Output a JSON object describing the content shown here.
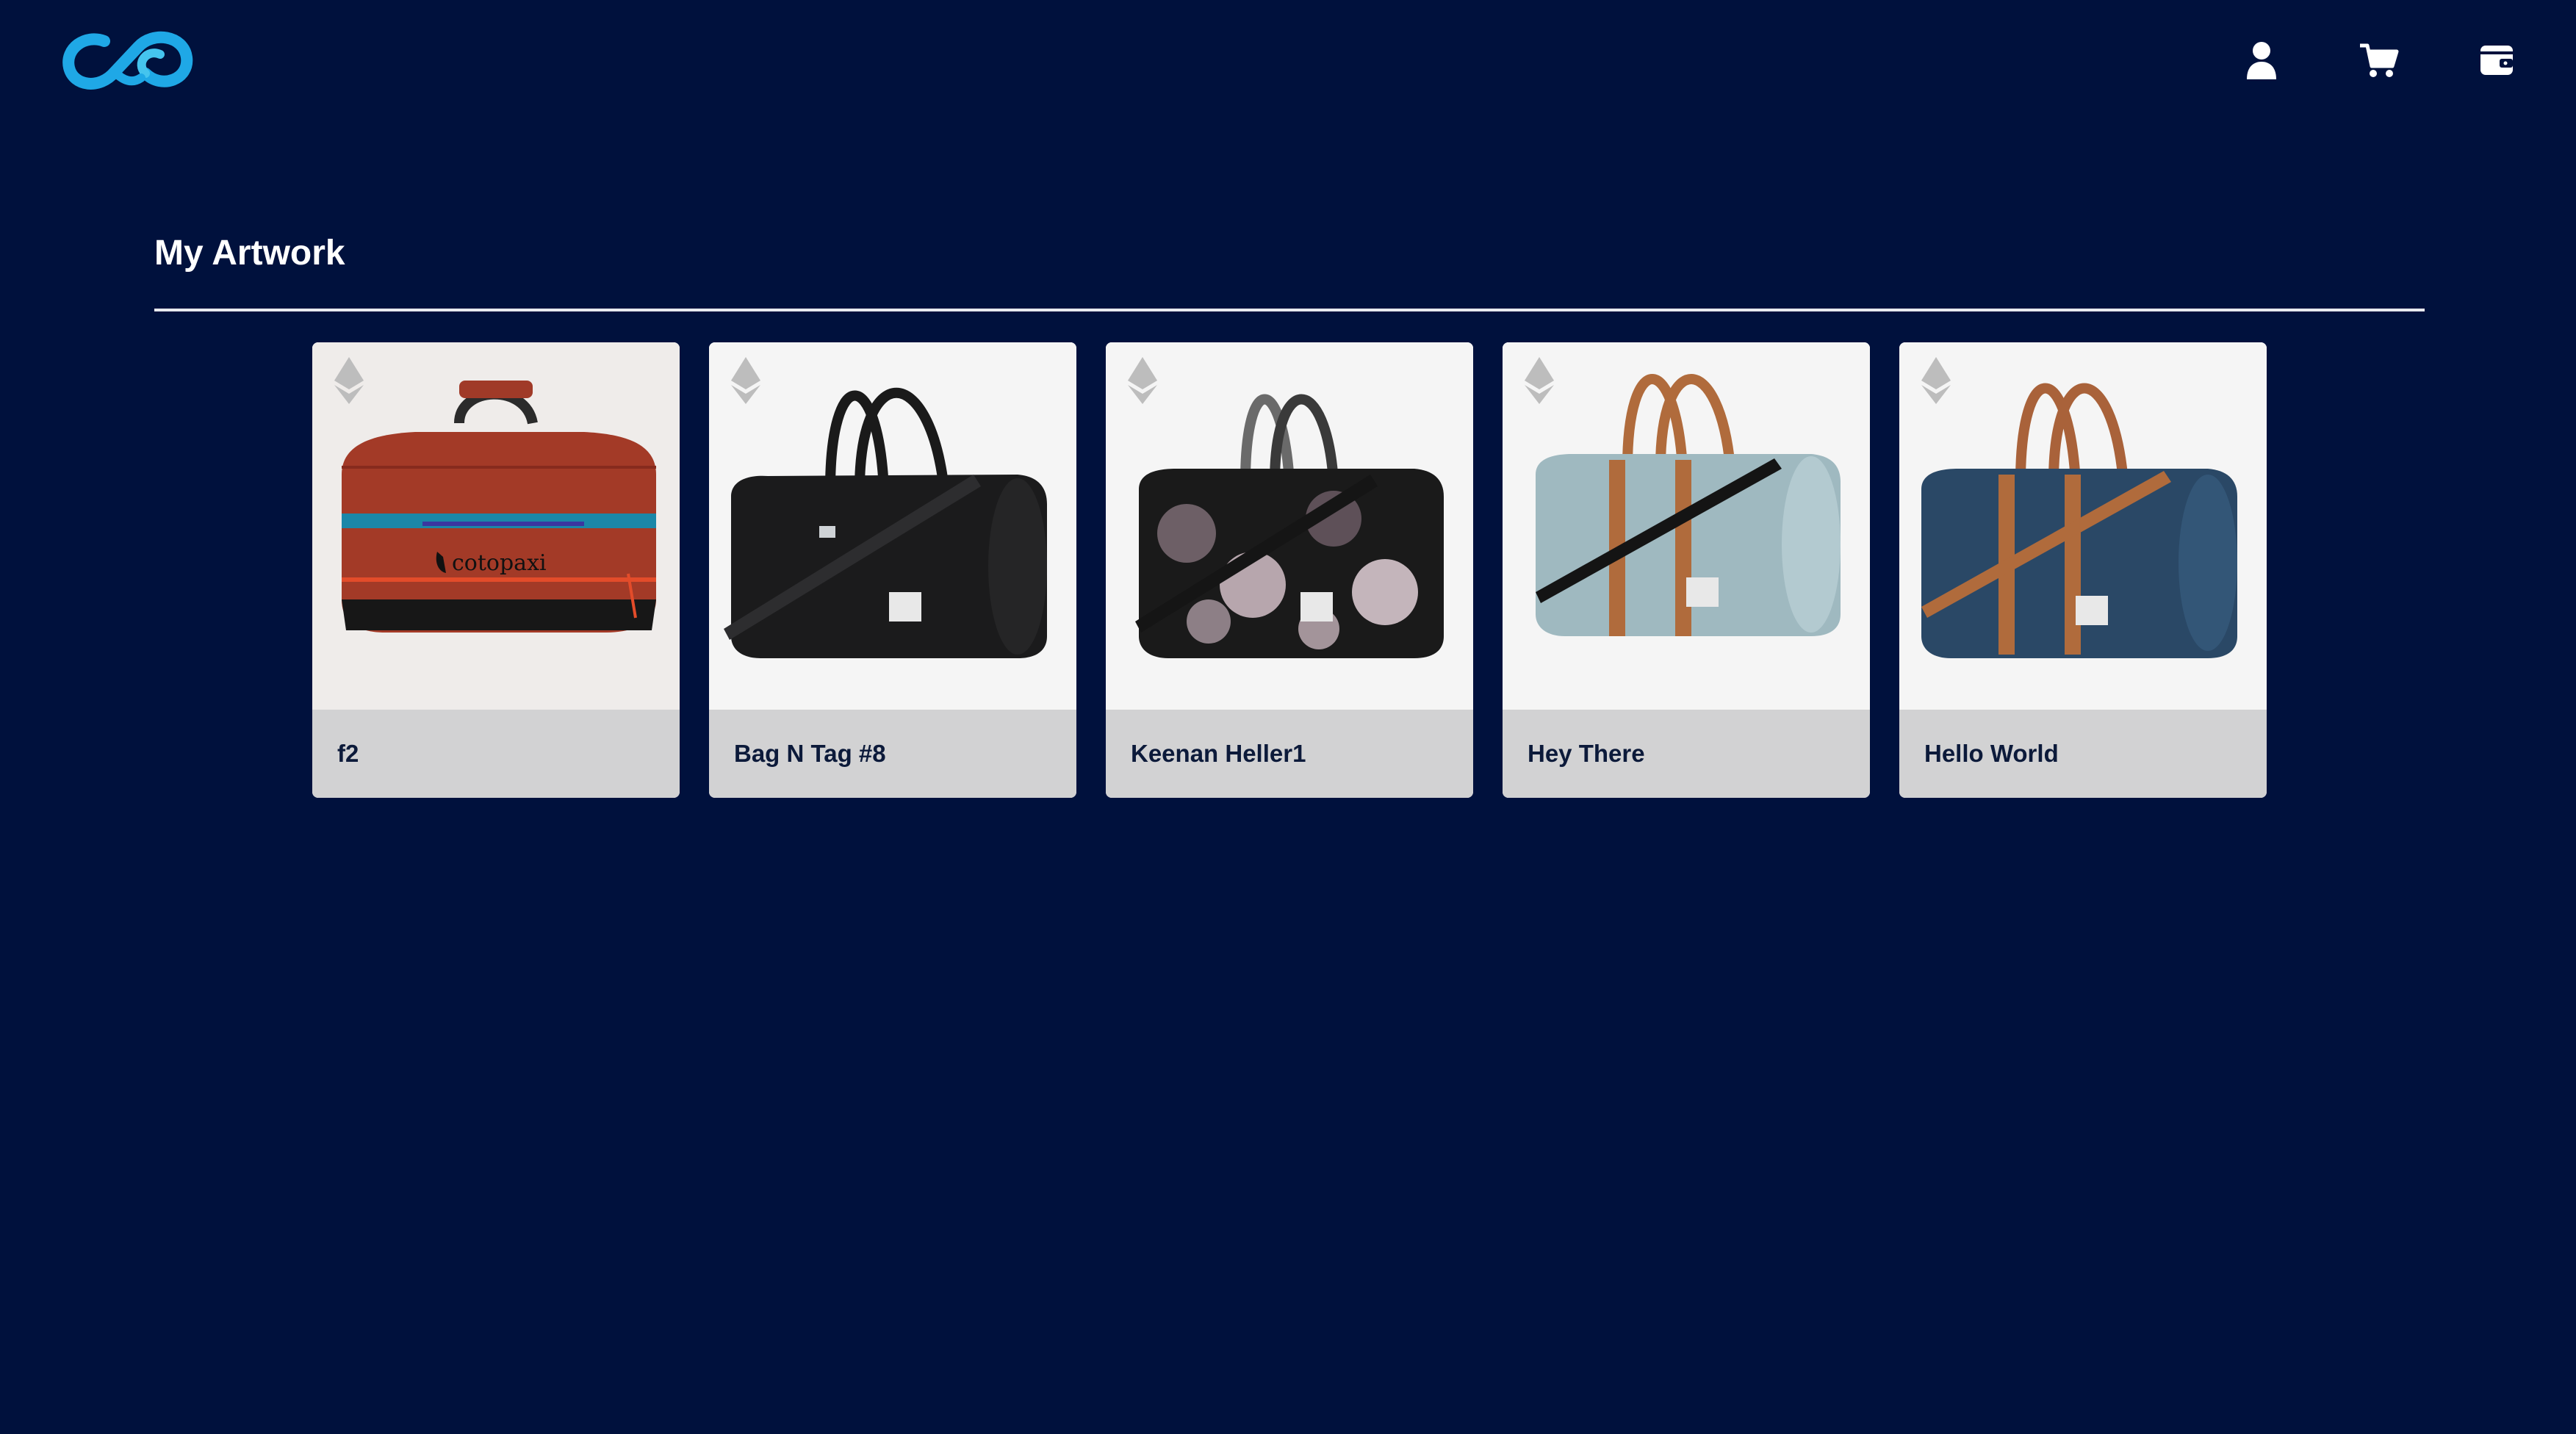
{
  "header": {
    "logo_icon": "infinity-logo-icon",
    "icons": [
      "user-icon",
      "cart-icon",
      "wallet-icon"
    ]
  },
  "main": {
    "title": "My Artwork"
  },
  "artworks": [
    {
      "title": "f2",
      "currency_icon": "ethereum-icon",
      "image": "red-cotopaxi-duffel-bag",
      "logo_text": "cotopaxi"
    },
    {
      "title": "Bag N Tag #8",
      "currency_icon": "ethereum-icon",
      "image": "black-duffel-bag"
    },
    {
      "title": "Keenan Heller1",
      "currency_icon": "ethereum-icon",
      "image": "tie-dye-duffel-bag"
    },
    {
      "title": "Hey There",
      "currency_icon": "ethereum-icon",
      "image": "light-blue-duffel-bag"
    },
    {
      "title": "Hello World",
      "currency_icon": "ethereum-icon",
      "image": "navy-duffel-bag"
    }
  ],
  "colors": {
    "background": "#00113d",
    "logo_accent": "#1fa8e6",
    "card_caption": "#d2d2d3",
    "bag_red": "#a33a27",
    "bag_black": "#1b1b1c",
    "bag_blue": "#9fb9c0",
    "bag_navy": "#2a4866",
    "strap_tan": "#b06b3c"
  }
}
